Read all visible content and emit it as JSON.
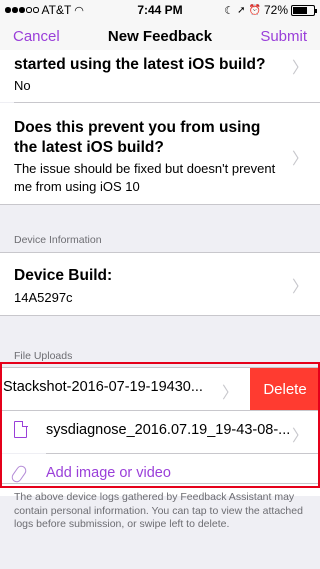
{
  "status_bar": {
    "carrier": "AT&T",
    "time": "7:44 PM",
    "battery_percent": "72%",
    "battery_level": 0.72
  },
  "nav": {
    "cancel": "Cancel",
    "title": "New Feedback",
    "submit": "Submit"
  },
  "questions": [
    {
      "question": "started using the latest iOS build?",
      "answer": "No"
    },
    {
      "question": "Does this prevent you from using the latest iOS build?",
      "answer": "The issue should be fixed but doesn't prevent me from using iOS 10"
    }
  ],
  "device_information": {
    "header": "Device Information",
    "build_label": "Device Build:",
    "build_value": "14A5297c"
  },
  "file_uploads": {
    "header": "File Uploads",
    "files": [
      {
        "name": "Stackshot-2016-07-19-19430..."
      },
      {
        "name": "sysdiagnose_2016.07.19_19-43-08-..."
      }
    ],
    "delete_label": "Delete",
    "add_label": "Add image or video"
  },
  "footer": "The above device logs gathered by Feedback Assistant may contain personal information. You can tap to view the attached logs before submission, or swipe left to delete.",
  "colors": {
    "accent": "#9a3fd9",
    "delete": "#ff3b30",
    "highlight": "#e5001a"
  }
}
